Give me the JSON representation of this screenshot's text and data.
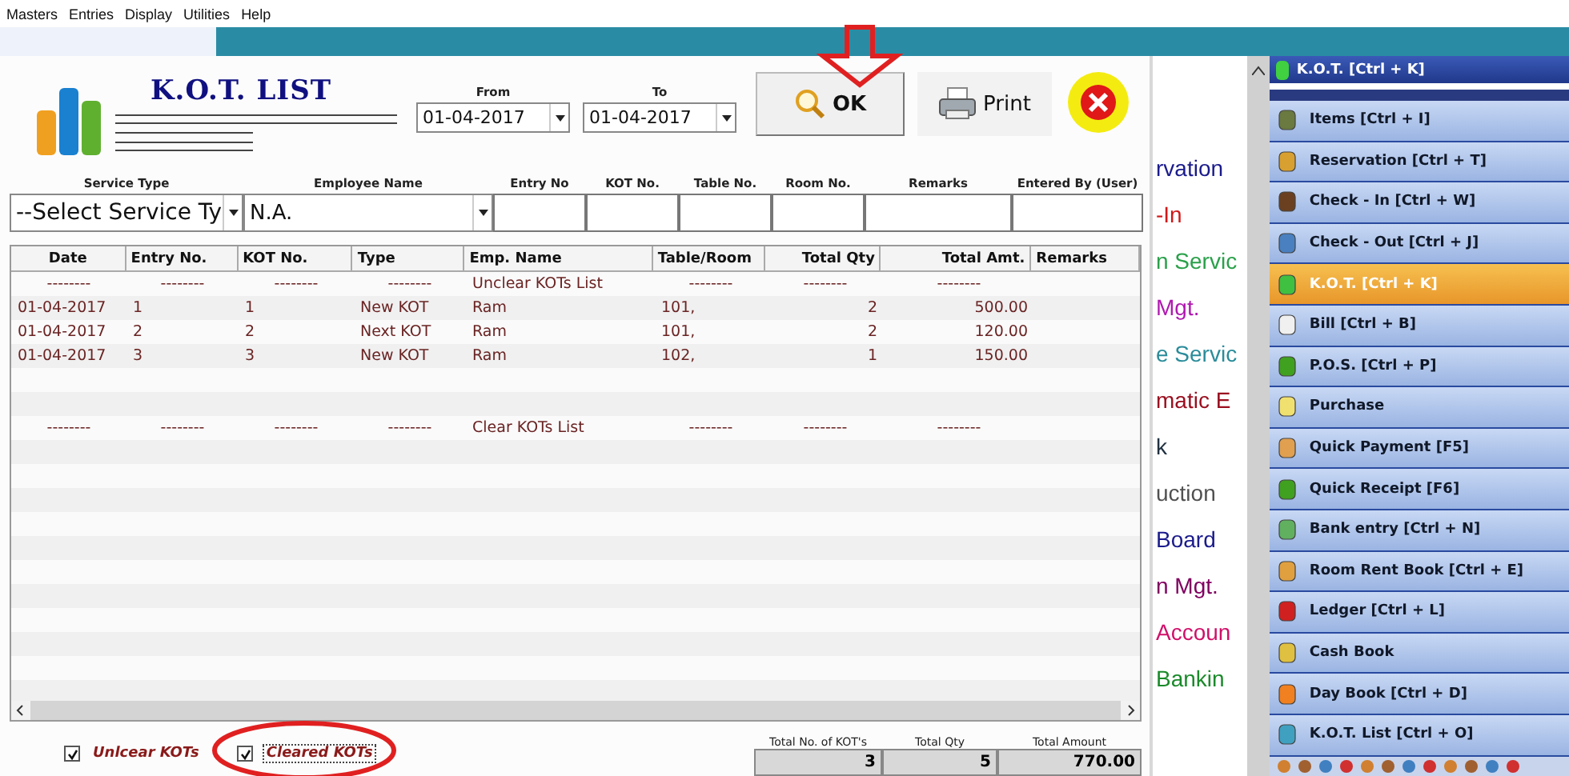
{
  "menu_bar": [
    "Masters",
    "Entries",
    "Display",
    "Utilities",
    "Help"
  ],
  "window": {
    "title": "K.O.T. LIST",
    "from": {
      "label": "From",
      "value": "01-04-2017"
    },
    "to": {
      "label": "To",
      "value": "01-04-2017"
    },
    "buttons": [
      {
        "kind": "ok",
        "label": "OK"
      },
      {
        "kind": "print",
        "label": "Print"
      },
      {
        "kind": "close"
      }
    ]
  },
  "filters": [
    {
      "label": "Service Type",
      "kind": "select",
      "value": "--Select Service Ty"
    },
    {
      "label": "Employee Name",
      "kind": "select",
      "value": "N.A."
    },
    {
      "label": "Entry No",
      "kind": "text"
    },
    {
      "label": "KOT No.",
      "kind": "text"
    },
    {
      "label": "Table No.",
      "kind": "text"
    },
    {
      "label": "Room No.",
      "kind": "text"
    },
    {
      "label": "Remarks",
      "kind": "text"
    },
    {
      "label": "Entered By (User)",
      "kind": "text"
    }
  ],
  "table": {
    "columns": [
      "Date",
      "Entry No.",
      "KOT No.",
      "Type",
      "Emp. Name",
      "Table/Room",
      "Total Qty",
      "Total Amt.",
      "Remarks"
    ],
    "rows": [
      {
        "kind": "separator",
        "cells": [
          "--------",
          "--------",
          "--------",
          "--------",
          "Unclear KOTs List",
          "--------",
          "--------",
          "--------"
        ]
      },
      {
        "kind": "data",
        "cells": [
          "01-04-2017",
          "1",
          "1",
          "New KOT",
          "Ram",
          "101,",
          "2",
          "500.00"
        ]
      },
      {
        "kind": "data",
        "cells": [
          "01-04-2017",
          "2",
          "2",
          "Next KOT",
          "Ram",
          "101,",
          "2",
          "120.00"
        ]
      },
      {
        "kind": "data",
        "cells": [
          "01-04-2017",
          "3",
          "3",
          "New KOT",
          "Ram",
          "102,",
          "1",
          "150.00"
        ]
      },
      {
        "kind": "empty"
      },
      {
        "kind": "empty"
      },
      {
        "kind": "separator",
        "cells": [
          "--------",
          "--------",
          "--------",
          "--------",
          "Clear KOTs List",
          "--------",
          "--------",
          "--------"
        ]
      }
    ]
  },
  "options": [
    {
      "label": "Unlcear KOTs",
      "checked": true,
      "focused": false
    },
    {
      "label": "Cleared KOTs",
      "checked": true,
      "focused": true
    }
  ],
  "totals": [
    {
      "label": "Total No. of KOT's",
      "value": "3"
    },
    {
      "label": "Total Qty",
      "value": "5"
    },
    {
      "label": "Total Amount",
      "value": "770.00"
    }
  ],
  "background_menu": [
    {
      "text": "rvation",
      "color": "#1b1b8c"
    },
    {
      "text": "-In",
      "color": "#d01818"
    },
    {
      "text": "n Servic",
      "color": "#2aa04a"
    },
    {
      "text": "Mgt.",
      "color": "#b01ab0"
    },
    {
      "text": "e Servic",
      "color": "#2a8c9a"
    },
    {
      "text": "matic E",
      "color": "#9a1020"
    },
    {
      "text": "k",
      "color": "#203040"
    },
    {
      "text": "uction",
      "color": "#505050"
    },
    {
      "text": "Board",
      "color": "#1b1b8c"
    },
    {
      "text": "n Mgt.",
      "color": "#800060"
    },
    {
      "text": "Accoun",
      "color": "#d0106a"
    },
    {
      "text": "Bankin",
      "color": "#1a8a2a"
    }
  ],
  "sidebar": {
    "header": "K.O.T. [Ctrl + K]",
    "items": [
      {
        "label": "Items [Ctrl + I]",
        "selected": false
      },
      {
        "label": "Reservation [Ctrl + T]",
        "selected": false
      },
      {
        "label": "Check - In [Ctrl + W]",
        "selected": false
      },
      {
        "label": "Check - Out [Ctrl + J]",
        "selected": false
      },
      {
        "label": "K.O.T. [Ctrl + K]",
        "selected": true
      },
      {
        "label": "Bill [Ctrl + B]",
        "selected": false
      },
      {
        "label": "P.O.S. [Ctrl + P]",
        "selected": false
      },
      {
        "label": "Purchase",
        "selected": false
      },
      {
        "label": "Quick Payment [F5]",
        "selected": false
      },
      {
        "label": "Quick Receipt [F6]",
        "selected": false
      },
      {
        "label": "Bank entry [Ctrl + N]",
        "selected": false
      },
      {
        "label": "Room Rent Book [Ctrl + E]",
        "selected": false
      },
      {
        "label": "Ledger [Ctrl + L]",
        "selected": false
      },
      {
        "label": "Cash Book",
        "selected": false
      },
      {
        "label": "Day Book [Ctrl + D]",
        "selected": false
      },
      {
        "label": "K.O.T. List [Ctrl + O]",
        "selected": false
      }
    ]
  }
}
